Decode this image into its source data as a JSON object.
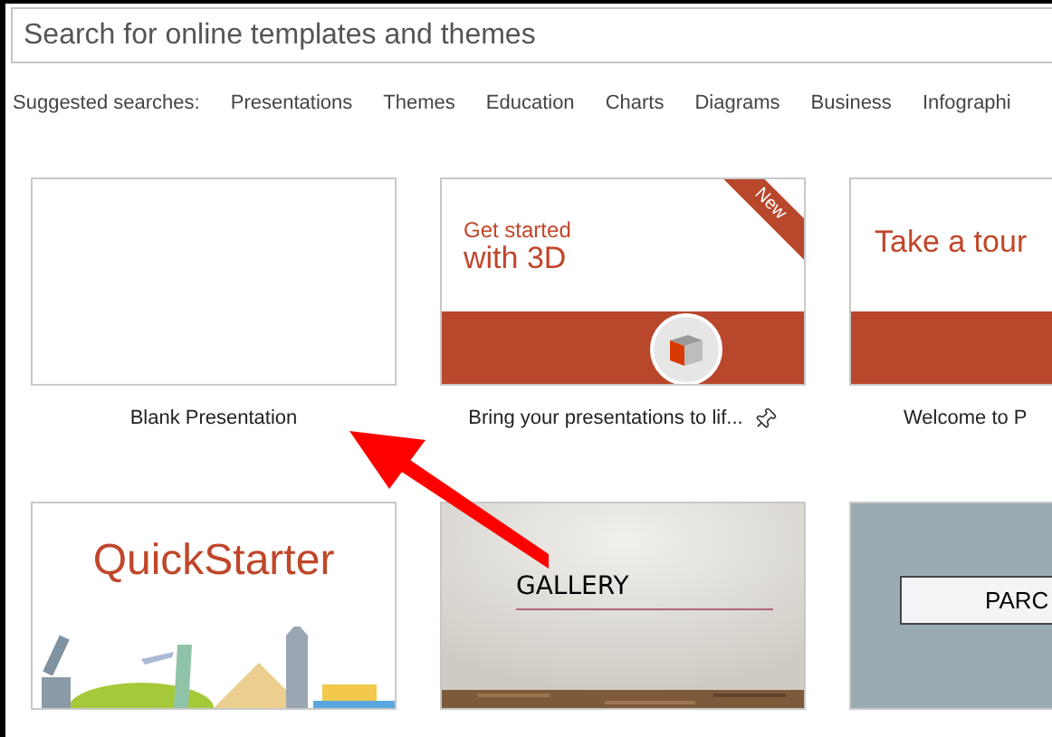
{
  "search": {
    "placeholder": "Search for online templates and themes"
  },
  "suggested": {
    "label": "Suggested searches:",
    "items": [
      "Presentations",
      "Themes",
      "Education",
      "Charts",
      "Diagrams",
      "Business",
      "Infographi"
    ]
  },
  "templates": [
    {
      "kind": "blank",
      "caption": "Blank Presentation"
    },
    {
      "kind": "get3d",
      "title_lines": [
        "Get started",
        "with 3D"
      ],
      "badge": "New",
      "caption": "Bring your presentations to lif...",
      "pinnable": true
    },
    {
      "kind": "tour",
      "title": "Take a tour",
      "caption": "Welcome to P"
    },
    {
      "kind": "quickstarter",
      "title": "QuickStarter"
    },
    {
      "kind": "gallery",
      "title": "GALLERY"
    },
    {
      "kind": "parcel",
      "title": "PARC"
    }
  ]
}
